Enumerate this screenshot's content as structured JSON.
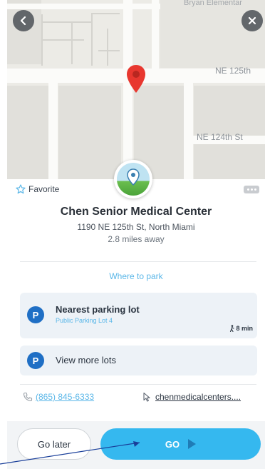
{
  "map": {
    "labels": {
      "top_right": "Bryan Elementar",
      "street_1": "NE 125th",
      "street_2": "NE 124th St"
    },
    "back_icon": "chevron-left-icon",
    "close_icon": "close-icon",
    "pin_color": "#e8372f"
  },
  "place": {
    "favorite_label": "Favorite",
    "name": "Chen Senior Medical Center",
    "address": "1190 NE 125th St, North Miami",
    "distance": "2.8 miles away"
  },
  "parking": {
    "header": "Where to park",
    "nearest": {
      "badge": "P",
      "title": "Nearest parking lot",
      "subtitle": "Public Parking Lot 4",
      "walk_time": "8 min"
    },
    "more": {
      "badge": "P",
      "label": "View more lots"
    }
  },
  "contact": {
    "phone": "(865) 845-6333",
    "website": "chenmedicalcenters...."
  },
  "actions": {
    "later_label": "Go later",
    "go_label": "GO"
  },
  "colors": {
    "accent": "#35b8ef",
    "badge": "#1f6fc5",
    "link": "#5bb7e8"
  }
}
